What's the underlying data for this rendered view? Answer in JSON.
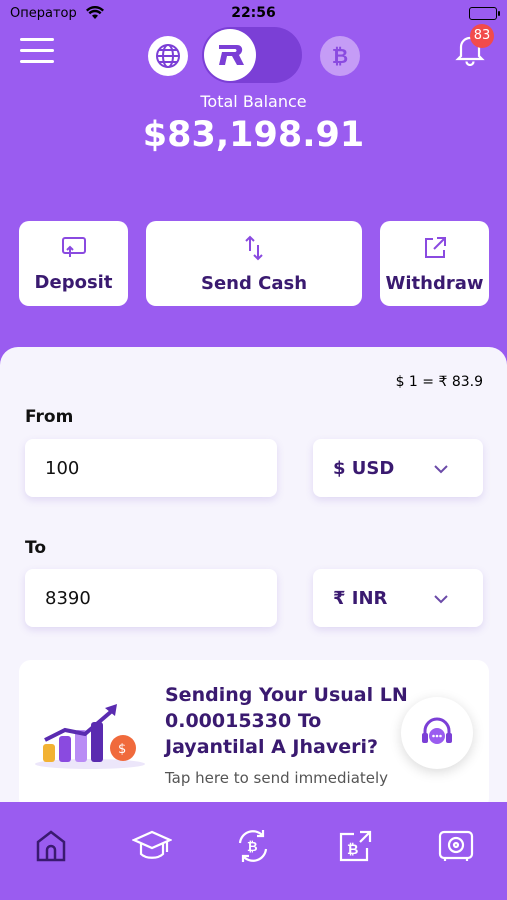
{
  "status_bar": {
    "carrier": "Оператор",
    "time": "22:56"
  },
  "header": {
    "notifications_count": "83",
    "toggle_left_icon": "globe-icon",
    "toggle_center_icon": "app-logo-icon",
    "toggle_right_icon": "bitcoin-icon",
    "btc_glyph": "₿"
  },
  "balance": {
    "label": "Total Balance",
    "value": "$83,198.91"
  },
  "actions": {
    "deposit": {
      "label": "Deposit",
      "icon": "deposit-icon"
    },
    "send": {
      "label": "Send Cash",
      "icon": "transfer-arrows-icon"
    },
    "withdraw": {
      "label": "Withdraw",
      "icon": "external-link-icon"
    }
  },
  "exchange": {
    "rate": "$ 1 = ₹ 83.9",
    "from_label": "From",
    "from_amount": "100",
    "from_currency": "$ USD",
    "to_label": "To",
    "to_amount": "8390",
    "to_currency": "₹ INR"
  },
  "promo": {
    "title": "Sending Your Usual LN 0.00015330 To Jayantilal A Jhaveri?",
    "subtitle": "Tap here to send immediately"
  },
  "bottom_nav": [
    "home-icon",
    "education-cap-icon",
    "bitcoin-exchange-icon",
    "bitcoin-transfer-icon",
    "vault-icon"
  ],
  "colors": {
    "brand": "#9a5cf0",
    "brand_dark": "#3a1a70",
    "badge": "#f24b4b"
  }
}
